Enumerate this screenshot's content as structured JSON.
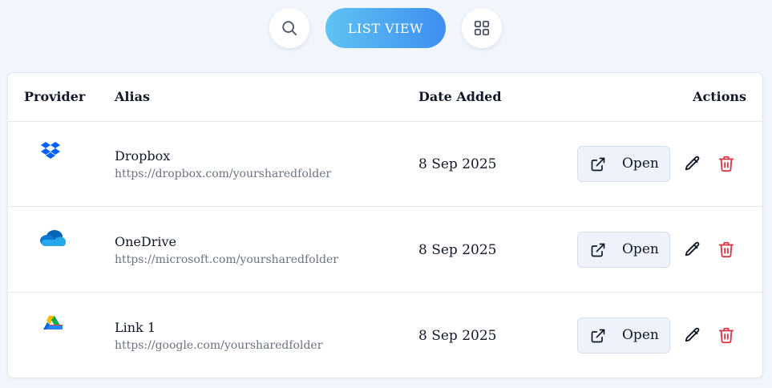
{
  "toolbar": {
    "list_view_label": "LIST VIEW",
    "search_icon": "search-icon",
    "grid_icon": "grid-icon",
    "accent_gradient": [
      "#5ec3f2",
      "#3f8ef0"
    ]
  },
  "table": {
    "headers": {
      "provider": "Provider",
      "alias": "Alias",
      "date_added": "Date Added",
      "actions": "Actions"
    },
    "rows": [
      {
        "provider_icon": "dropbox-icon",
        "alias": "Dropbox",
        "url": "https://dropbox.com/yoursharedfolder",
        "date_added": "8 Sep 2025",
        "open_label": "Open"
      },
      {
        "provider_icon": "onedrive-icon",
        "alias": "OneDrive",
        "url": "https://microsoft.com/yoursharedfolder",
        "date_added": "8 Sep 2025",
        "open_label": "Open"
      },
      {
        "provider_icon": "google-drive-icon",
        "alias": "Link 1",
        "url": "https://google.com/yoursharedfolder",
        "date_added": "8 Sep 2025",
        "open_label": "Open"
      }
    ]
  },
  "colors": {
    "delete": "#dc3545",
    "page_background": "#f1f5fc"
  }
}
